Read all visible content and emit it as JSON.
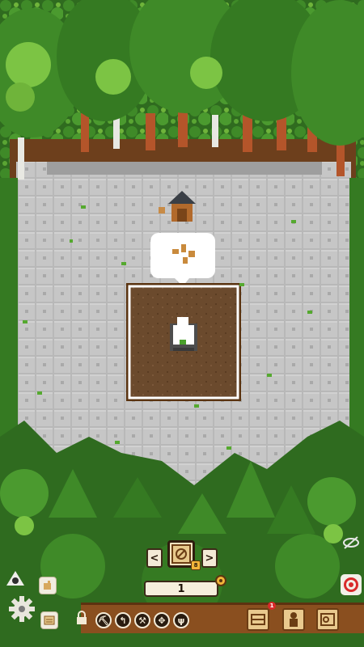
{
  "selector": {
    "prev_label": "<",
    "next_label": ">",
    "selected_item_icon": "compass-tile-icon",
    "badge_value": "8"
  },
  "quantity": {
    "value": "1",
    "coin_icon": "coin-icon"
  },
  "toolbar": {
    "lock_icon": "padlock-icon",
    "tools": [
      {
        "name": "pickaxe-tool",
        "glyph": "⛏"
      },
      {
        "name": "hook-tool",
        "glyph": "↰"
      },
      {
        "name": "hammer-tool",
        "glyph": "⚒"
      },
      {
        "name": "move-tool",
        "glyph": "✥"
      },
      {
        "name": "sprout-tool",
        "glyph": "ψ"
      }
    ],
    "cards": [
      {
        "name": "build-card",
        "badge": "1"
      },
      {
        "name": "character-card",
        "badge": ""
      },
      {
        "name": "map-card",
        "badge": ""
      }
    ]
  },
  "side": {
    "settings_icon": "gear-icon",
    "leaf_icon": "leaf-icon",
    "scroll_icon": "scroll-icon",
    "target_icon": "target-icon",
    "visibility_icon": "eye-slash-icon"
  },
  "colors": {
    "forest_dark": "#2f6b1f",
    "forest_light": "#6fb43a",
    "stone": "#b9b9b9",
    "soil": "#6a4a2e",
    "wood": "#8a4f1f",
    "accent_red": "#d92a2a"
  }
}
